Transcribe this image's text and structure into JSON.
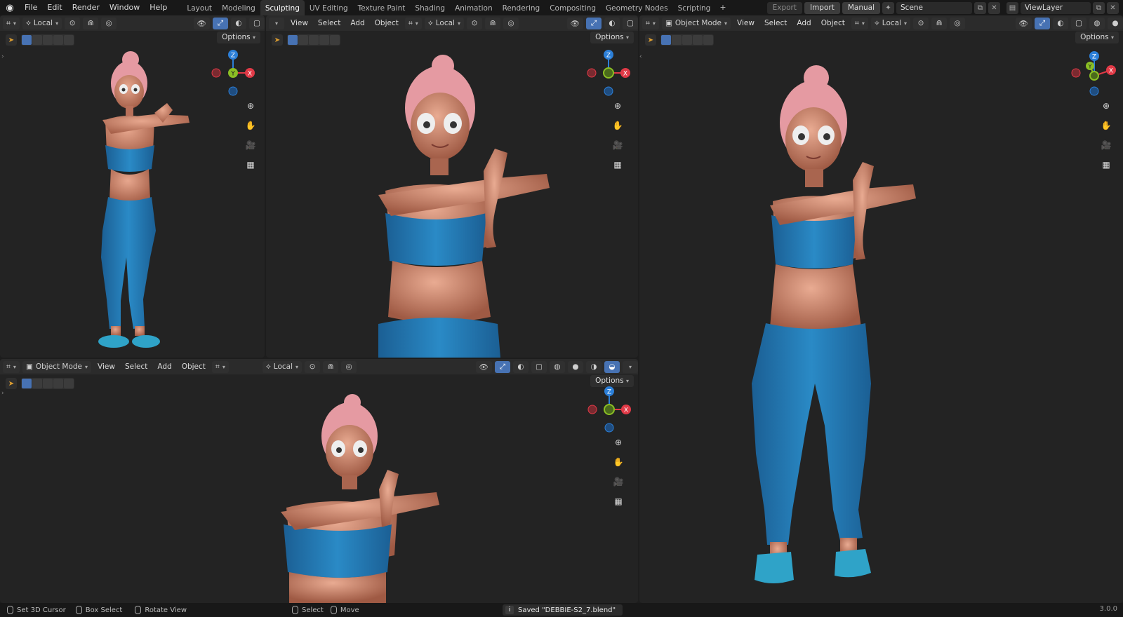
{
  "topbar": {
    "menus": [
      "File",
      "Edit",
      "Render",
      "Window",
      "Help"
    ],
    "workspaces": [
      "Layout",
      "Modeling",
      "Sculpting",
      "UV Editing",
      "Texture Paint",
      "Shading",
      "Animation",
      "Rendering",
      "Compositing",
      "Geometry Nodes",
      "Scripting"
    ],
    "active_workspace": "Sculpting",
    "export_label": "Export",
    "import_label": "Import",
    "manual_label": "Manual",
    "scene_name": "Scene",
    "view_layer": "ViewLayer"
  },
  "viewport_common": {
    "transform_orientation": "Local",
    "options_label": "Options",
    "mode": "Object Mode",
    "menu_view": "View",
    "menu_select": "Select",
    "menu_add": "Add",
    "menu_object": "Object",
    "axes": {
      "x": "X",
      "y": "Y",
      "z": "Z"
    }
  },
  "statusbar": {
    "set_cursor": "Set 3D Cursor",
    "box_select": "Box Select",
    "rotate_view": "Rotate View",
    "select": "Select",
    "move": "Move",
    "saved_message": "Saved \"DEBBIE-S2_7.blend\"",
    "version": "3.0.0"
  },
  "colors": {
    "accent": "#4772b3",
    "axis_x": "#e13a47",
    "axis_y": "#8bbf24",
    "axis_z": "#2c7fd8",
    "skin": "#d58f76",
    "hair": "#e49aa0",
    "outfit": "#2a83be"
  }
}
